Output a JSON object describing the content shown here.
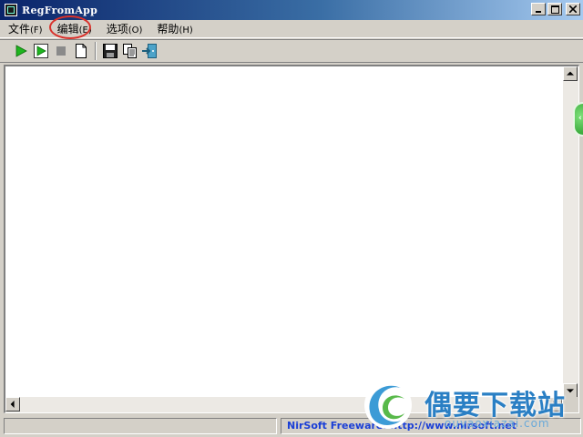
{
  "window": {
    "title": "RegFromApp"
  },
  "menu": [
    {
      "label": "文件",
      "accel": "(F)"
    },
    {
      "label": "编辑",
      "accel": "(E)"
    },
    {
      "label": "选项",
      "accel": "(O)"
    },
    {
      "label": "帮助",
      "accel": "(H)"
    }
  ],
  "toolbar": {
    "icons": [
      "play-icon",
      "play-outline-icon",
      "stop-icon",
      "new-document-icon",
      "save-icon",
      "copy-icon",
      "exit-icon"
    ]
  },
  "status": {
    "left_text": "",
    "link_text": "NirSoft Freeware.  http://www.nirsoft.net"
  },
  "watermark": {
    "title": "偶要下载站",
    "subtitle": "ouyaoxiazai.com"
  },
  "colors": {
    "titlebar_start": "#0a246a",
    "titlebar_end": "#a6caf0",
    "status_link": "#1a3fd6",
    "annotation_circle": "#d9312b",
    "watermark_blue": "#2a7fc4"
  }
}
